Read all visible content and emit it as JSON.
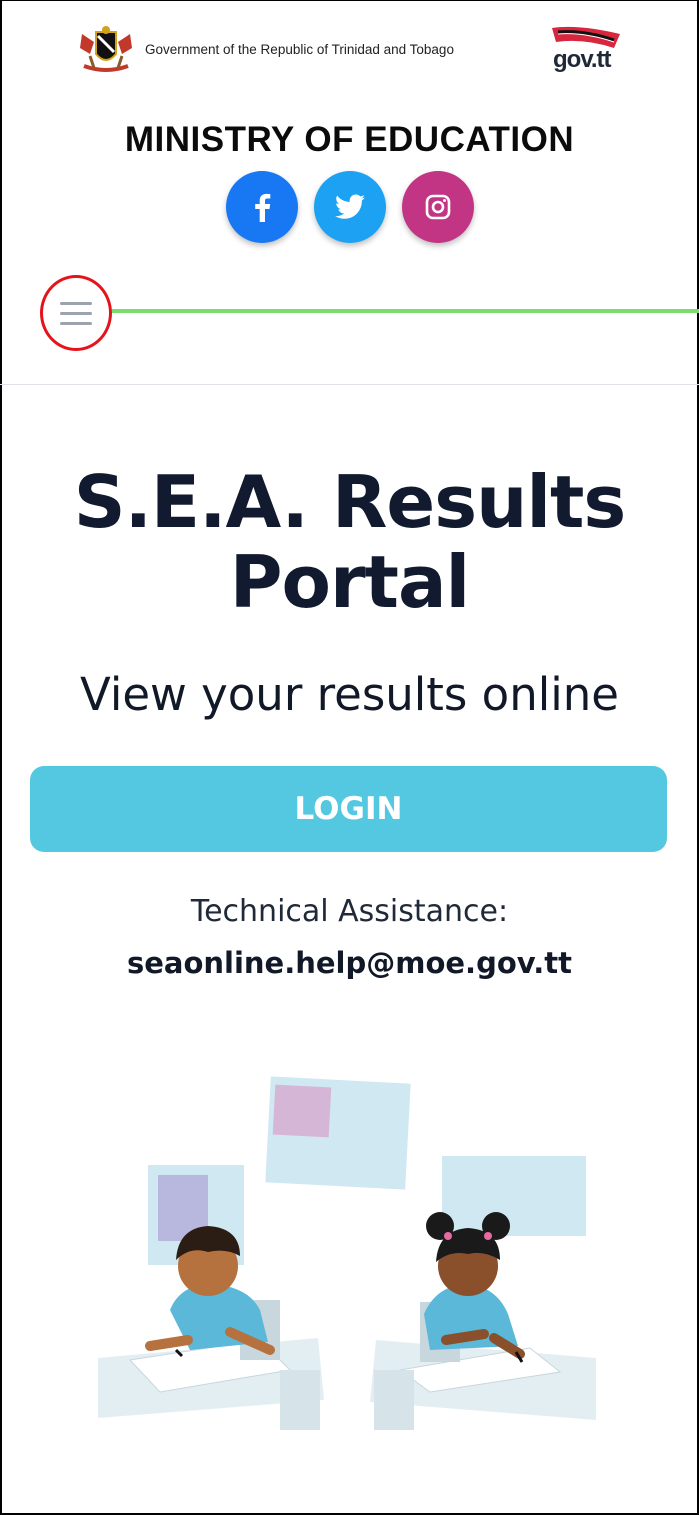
{
  "header": {
    "gov_text": "Government of the Republic of Trinidad and Tobago",
    "gov_logo_text": "gov.tt",
    "ministry_title": "MINISTRY OF EDUCATION"
  },
  "socials": [
    {
      "name": "facebook",
      "icon": "facebook-icon",
      "color": "#1877f2"
    },
    {
      "name": "twitter",
      "icon": "twitter-icon",
      "color": "#1da1f2"
    },
    {
      "name": "instagram",
      "icon": "instagram-icon",
      "color": "#c13584"
    }
  ],
  "nav": {
    "menu_icon": "hamburger-menu-icon",
    "accent": "#7ddc6c",
    "highlight": "#e3141b"
  },
  "main": {
    "title": "S.E.A. Results Portal",
    "subtitle": "View your results online",
    "login_label": "LOGIN",
    "login_color": "#54c7e1",
    "tech_label": "Technical Assistance:",
    "tech_email": "seaonline.help@moe.gov.tt"
  }
}
